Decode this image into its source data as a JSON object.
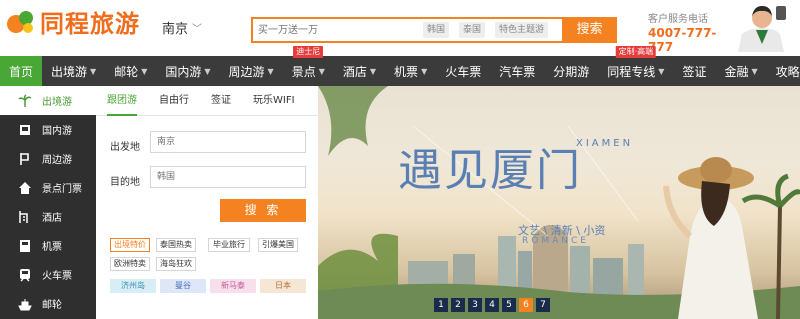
{
  "header": {
    "logo_text": "同程旅游",
    "city": "南京",
    "search_placeholder": "买一万送一万",
    "search_tags": [
      "韩国",
      "泰国",
      "特色主题游"
    ],
    "search_button": "搜索",
    "service_label": "客户服务电话",
    "service_phone": "4007-777-777"
  },
  "nav": {
    "items": [
      {
        "label": "首页",
        "active": true,
        "chevron": false,
        "badge": ""
      },
      {
        "label": "出境游",
        "chevron": true,
        "badge": ""
      },
      {
        "label": "邮轮",
        "chevron": true,
        "badge": ""
      },
      {
        "label": "国内游",
        "chevron": true,
        "badge": ""
      },
      {
        "label": "周边游",
        "chevron": true,
        "badge": ""
      },
      {
        "label": "景点",
        "chevron": true,
        "badge": "迪士尼"
      },
      {
        "label": "酒店",
        "chevron": true,
        "badge": ""
      },
      {
        "label": "机票",
        "chevron": true,
        "badge": ""
      },
      {
        "label": "火车票",
        "chevron": false,
        "badge": ""
      },
      {
        "label": "汽车票",
        "chevron": false,
        "badge": ""
      },
      {
        "label": "分期游",
        "chevron": false,
        "badge": ""
      },
      {
        "label": "同程专线",
        "chevron": true,
        "badge": "定制·高端"
      },
      {
        "label": "签证",
        "chevron": false,
        "badge": ""
      },
      {
        "label": "金融",
        "chevron": true,
        "badge": ""
      },
      {
        "label": "攻略",
        "chevron": true,
        "badge": ""
      }
    ]
  },
  "sidebar": {
    "items": [
      {
        "label": "出境游",
        "icon": "palm-tree-icon",
        "active": true
      },
      {
        "label": "国内游",
        "icon": "flag-icon"
      },
      {
        "label": "周边游",
        "icon": "pin-icon"
      },
      {
        "label": "景点门票",
        "icon": "house-icon"
      },
      {
        "label": "酒店",
        "icon": "hotel-icon"
      },
      {
        "label": "机票",
        "icon": "plane-icon"
      },
      {
        "label": "火车票",
        "icon": "train-icon"
      },
      {
        "label": "邮轮",
        "icon": "ship-icon"
      }
    ]
  },
  "panel": {
    "tabs": [
      "跟团游",
      "自由行",
      "签证",
      "玩乐WIFI"
    ],
    "from_label": "出发地",
    "from_value": "南京",
    "to_label": "目的地",
    "to_value": "韩国",
    "search_button": "搜 索",
    "chips_row1": [
      "出境特价",
      "泰国热卖",
      "毕业旅行",
      "引爆美国"
    ],
    "chips_row2": [
      "欧洲特卖",
      "海岛狂欢"
    ],
    "chips_row3": [
      "济州岛",
      "曼谷",
      "新马泰",
      "日本"
    ],
    "chip_colors": [
      "#d8eef6",
      "#dde7f8",
      "#f7e0ec",
      "#f6e6d6"
    ],
    "chip_text_colors": [
      "#3a8ab0",
      "#4a6bbd",
      "#c75a96",
      "#b07040"
    ]
  },
  "banner": {
    "headline": "遇见厦门",
    "en_title": "XIAMEN",
    "subtitle": "文艺 \\ 清新 \\ 小资",
    "en_sub": "ROMANCE",
    "pages": [
      "1",
      "2",
      "3",
      "4",
      "5",
      "6",
      "7"
    ],
    "active_page": "6"
  },
  "colors": {
    "brand_orange": "#f58220",
    "nav_bg": "#3b3b3b",
    "nav_active": "#49a736",
    "sidebar_bg": "#2f2f2f"
  }
}
